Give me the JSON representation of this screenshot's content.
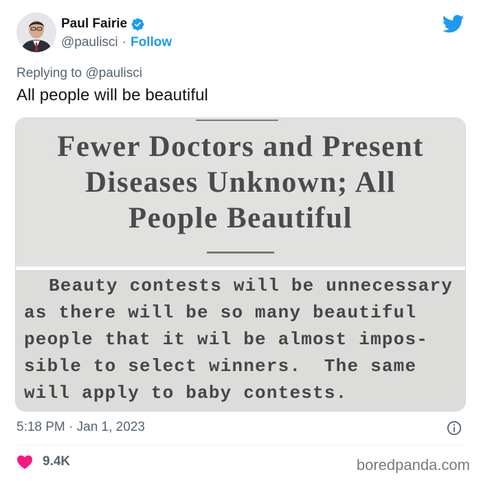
{
  "tweet": {
    "author": {
      "name": "Paul Fairie",
      "handle": "@paulisci",
      "separator": "·",
      "follow_label": "Follow",
      "verified": true
    },
    "reply_prefix": "Replying to",
    "reply_to": "@paulisci",
    "text": "All people will be beautiful",
    "media": {
      "headline_lines": [
        "Fewer Doctors and Present",
        "Diseases Unknown; All",
        "People Beautiful"
      ],
      "body_lines": [
        "Beauty contests will be unnecessary",
        "as there will be so many beautiful",
        "people that it wil be almost impos-",
        "sible to select winners.  The same",
        "will apply to baby contests."
      ]
    },
    "timestamp": "5:18 PM · Jan 1, 2023",
    "likes": "9.4K"
  },
  "watermark": "boredpanda.com",
  "colors": {
    "twitter_blue": "#1d9bf0",
    "heart_red": "#f91880",
    "secondary_text": "#536471"
  },
  "icons": [
    "twitter-bird-icon",
    "verified-badge-icon",
    "info-icon",
    "heart-icon"
  ]
}
